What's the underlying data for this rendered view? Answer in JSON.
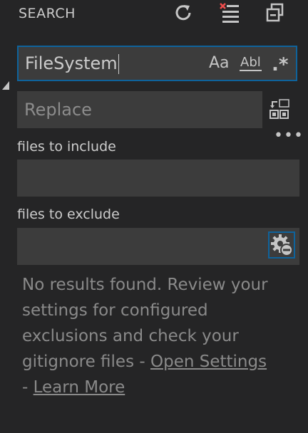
{
  "header": {
    "title": "SEARCH",
    "icons": [
      "refresh-icon",
      "clear-results-icon",
      "collapse-all-icon"
    ]
  },
  "search": {
    "value": "FileSystem",
    "option_case": "Aa",
    "option_word": "Abl",
    "option_regex": ".*"
  },
  "replace": {
    "placeholder": "Replace"
  },
  "more": "•••",
  "include": {
    "label": "files to include",
    "value": ""
  },
  "exclude": {
    "label": "files to exclude",
    "value": ""
  },
  "message": {
    "text": "No results found. Review your settings for configured exclusions and check your gitignore files -",
    "separator": "-",
    "link_settings": "Open Settings",
    "link_learn": "Learn More"
  },
  "colors": {
    "background": "#252526",
    "input": "#3c3c3c",
    "focus_border": "#0e639c",
    "clear_red": "#f14c4c"
  }
}
